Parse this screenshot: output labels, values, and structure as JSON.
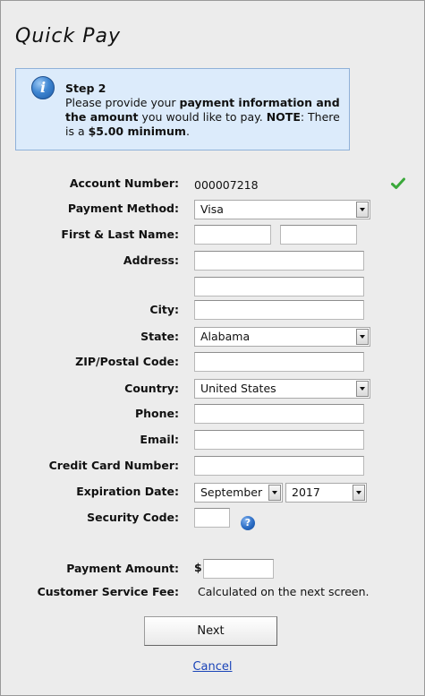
{
  "header": {
    "title": "Quick Pay"
  },
  "info": {
    "step": "Step 2",
    "t1": "Please provide your ",
    "b1": "payment information and the amount",
    "t2": " you would like to pay. ",
    "b2": "NOTE",
    "t3": ": There is a ",
    "b3": "$5.00 minimum",
    "t4": "."
  },
  "form": {
    "account_label": "Account Number:",
    "account_value": "000007218",
    "payment_method_label": "Payment Method:",
    "payment_method_value": "Visa",
    "name_label": "First & Last Name:",
    "first_name_value": "",
    "last_name_value": "",
    "address_label": "Address:",
    "address1_value": "",
    "address2_value": "",
    "city_label": "City:",
    "city_value": "",
    "state_label": "State:",
    "state_value": "Alabama",
    "zip_label": "ZIP/Postal Code:",
    "zip_value": "",
    "country_label": "Country:",
    "country_value": "United States",
    "phone_label": "Phone:",
    "phone_value": "",
    "email_label": "Email:",
    "email_value": "",
    "card_label": "Credit Card Number:",
    "card_value": "",
    "expiration_label": "Expiration Date:",
    "exp_month_value": "September",
    "exp_year_value": "2017",
    "security_label": "Security Code:",
    "security_value": "",
    "amount_label": "Payment Amount:",
    "currency_symbol": "$",
    "amount_value": "",
    "fee_label": "Customer Service Fee:",
    "fee_value": "Calculated on the next screen."
  },
  "actions": {
    "next_label": "Next",
    "cancel_label": "Cancel"
  },
  "icons": {
    "valid": "check-icon",
    "info": "info-icon",
    "help": "help-icon",
    "check_color": "#3aa83a",
    "info_color": "#2a6cc4"
  }
}
